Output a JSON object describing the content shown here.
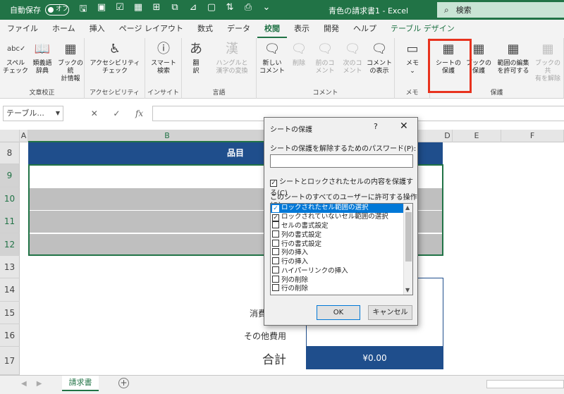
{
  "titlebar": {
    "autosave_label": "自動保存",
    "autosave_state": "オフ",
    "doc_title": "青色の請求書1 - Excel",
    "search_placeholder": "検索",
    "accent": "#217346"
  },
  "tabs": [
    "ファイル",
    "ホーム",
    "挿入",
    "ページ レイアウト",
    "数式",
    "データ",
    "校閲",
    "表示",
    "開発",
    "ヘルプ",
    "テーブル デザイン"
  ],
  "active_tab": "校閲",
  "ribbon": {
    "groups": [
      {
        "label": "文章校正",
        "buttons": [
          {
            "label1": "スペル",
            "label2": "チェック",
            "icon": "spellcheck-icon",
            "glyph": "abc✓"
          },
          {
            "label1": "類義語",
            "label2": "辞典",
            "icon": "thesaurus-icon",
            "glyph": "📖"
          },
          {
            "label1": "ブックの統",
            "label2": "計情報",
            "icon": "workbook-statistics-icon",
            "glyph": "▦"
          }
        ]
      },
      {
        "label": "アクセシビリティ",
        "buttons": [
          {
            "label1": "アクセシビリティ",
            "label2": "チェック",
            "icon": "accessibility-check-icon",
            "glyph": "♿"
          }
        ]
      },
      {
        "label": "インサイト",
        "buttons": [
          {
            "label1": "スマート",
            "label2": "検索",
            "icon": "smart-lookup-icon",
            "glyph": "ⓘ"
          }
        ]
      },
      {
        "label": "言語",
        "buttons": [
          {
            "label1": "翻",
            "label2": "訳",
            "icon": "translate-icon",
            "glyph": "あ"
          },
          {
            "label1": "ハングルと",
            "label2": "漢字の変換",
            "icon": "hangul-hanja-icon",
            "glyph": "漢",
            "disabled": true
          }
        ]
      },
      {
        "label": "コメント",
        "buttons": [
          {
            "label1": "新しい",
            "label2": "コメント",
            "icon": "new-comment-icon",
            "glyph": "🗨"
          },
          {
            "label1": "削除",
            "label2": "",
            "icon": "delete-comment-icon",
            "glyph": "🗨",
            "disabled": true
          },
          {
            "label1": "前のコ",
            "label2": "メント",
            "icon": "previous-comment-icon",
            "glyph": "🗨",
            "disabled": true
          },
          {
            "label1": "次のコ",
            "label2": "メント",
            "icon": "next-comment-icon",
            "glyph": "🗨",
            "disabled": true
          },
          {
            "label1": "コメント",
            "label2": "の表示",
            "icon": "show-comments-icon",
            "glyph": "🗨"
          }
        ]
      },
      {
        "label": "メモ",
        "buttons": [
          {
            "label1": "メモ",
            "label2": "⌄",
            "icon": "notes-icon",
            "glyph": "▭"
          }
        ]
      },
      {
        "label": "保護",
        "buttons": [
          {
            "label1": "シートの",
            "label2": "保護",
            "icon": "protect-sheet-icon",
            "glyph": "▦"
          },
          {
            "label1": "ブックの",
            "label2": "保護",
            "icon": "protect-workbook-icon",
            "glyph": "▦"
          },
          {
            "label1": "範囲の編集",
            "label2": "を許可する",
            "icon": "allow-edit-ranges-icon",
            "glyph": "▦"
          },
          {
            "label1": "ブックの共",
            "label2": "有を解除",
            "icon": "unshare-workbook-icon",
            "glyph": "▦",
            "disabled": true
          }
        ]
      }
    ]
  },
  "formula_bar": {
    "name_box": "テーブル...",
    "cancel_glyph": "✕",
    "enter_glyph": "✓",
    "fx_glyph": "fx"
  },
  "grid": {
    "columns": [
      "A",
      "B",
      "D",
      "E",
      "F"
    ],
    "rows": [
      "8",
      "9",
      "10",
      "11",
      "12",
      "13",
      "14",
      "15",
      "16",
      "17"
    ],
    "header_text": "品目",
    "label_tax": "消費",
    "label_other": "その他費用",
    "label_total": "合計",
    "total_value": "¥0.00",
    "header_color": "#1f4e8c",
    "band_color": "#bfbfbf"
  },
  "sheet": {
    "tab": "請求書",
    "add_glyph": "+"
  },
  "dialog": {
    "title": "シートの保護",
    "help": "?",
    "close": "✕",
    "password_label": "シートの保護を解除するためのパスワード(P):",
    "protect_label": "シートとロックされたセルの内容を保護する(C)",
    "protect_checked": true,
    "allow_label": "このシートのすべてのユーザーに許可する操作(O):",
    "options": [
      {
        "label": "ロックされたセル範囲の選択",
        "checked": true,
        "selected": true
      },
      {
        "label": "ロックされていないセル範囲の選択",
        "checked": true
      },
      {
        "label": "セルの書式設定",
        "checked": false
      },
      {
        "label": "列の書式設定",
        "checked": false
      },
      {
        "label": "行の書式設定",
        "checked": false
      },
      {
        "label": "列の挿入",
        "checked": false
      },
      {
        "label": "行の挿入",
        "checked": false
      },
      {
        "label": "ハイパーリンクの挿入",
        "checked": false
      },
      {
        "label": "列の削除",
        "checked": false
      },
      {
        "label": "行の削除",
        "checked": false
      }
    ],
    "ok": "OK",
    "cancel": "キャンセル"
  }
}
